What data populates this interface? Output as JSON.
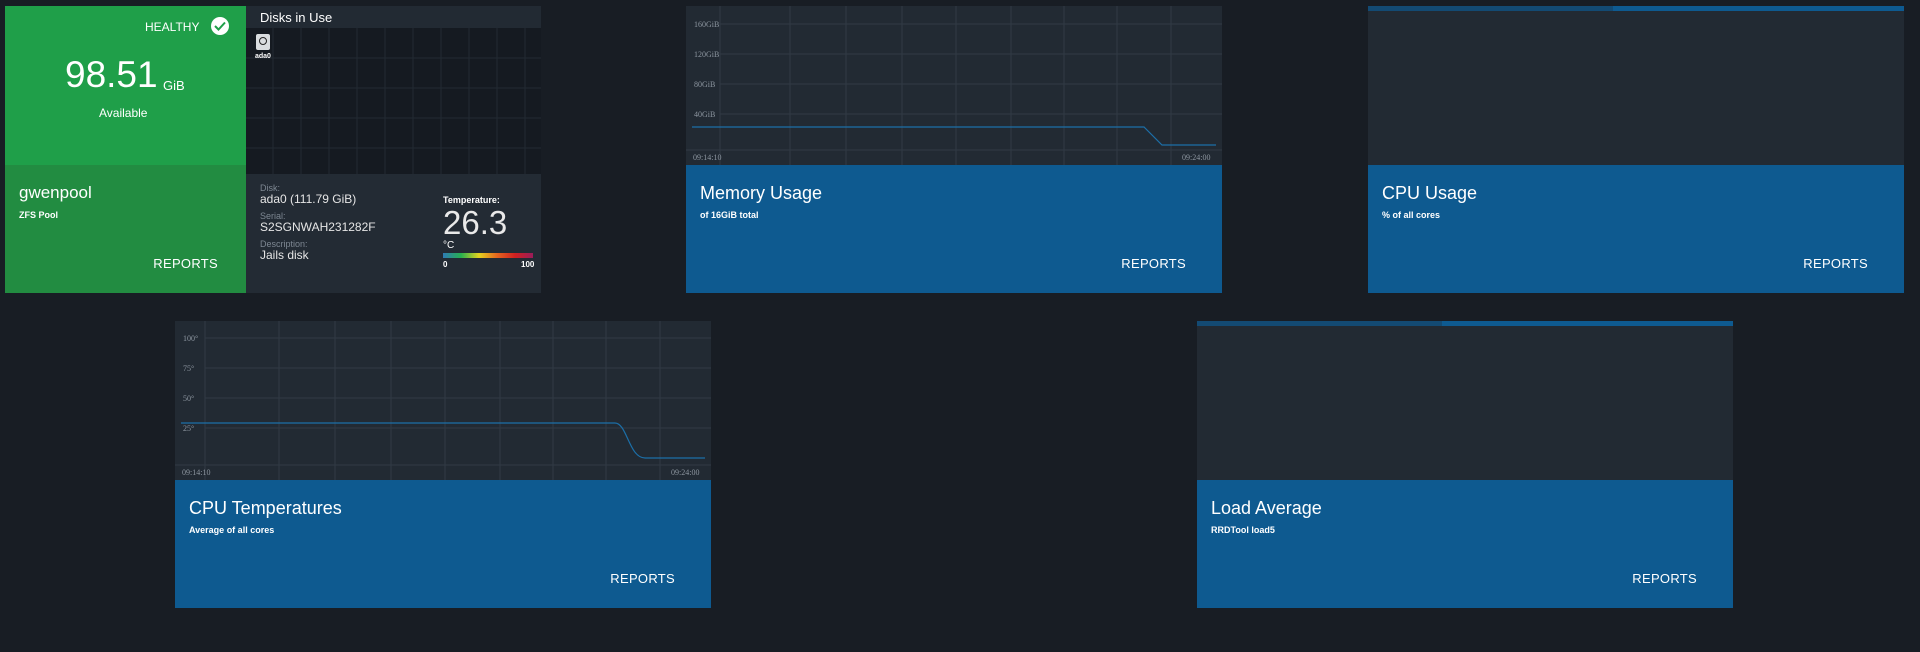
{
  "pool": {
    "status": "HEALTHY",
    "available_value": "98.51",
    "available_unit": "GiB",
    "available_label": "Available",
    "name": "gwenpool",
    "type": "ZFS Pool",
    "reports_label": "REPORTS",
    "disks_title": "Disks in Use",
    "disk_name": "ada0",
    "disk_label": "Disk:",
    "disk_value": "ada0 (111.79 GiB)",
    "serial_label": "Serial:",
    "serial_value": "S2SGNWAH231282F",
    "description_label": "Description:",
    "description_value": "Jails disk",
    "temperature_label": "Temperature:",
    "temperature_value": "26.3",
    "temperature_unit": "°C",
    "temp_scale_min": "0",
    "temp_scale_max": "100",
    "healthy_color": "#1f9f49"
  },
  "memory": {
    "title": "Memory Usage",
    "subtitle": "of 16GiB total",
    "reports_label": "REPORTS",
    "y_ticks": [
      "160GiB",
      "120GiB",
      "80GiB",
      "40GiB"
    ],
    "x_start": "09:14:10",
    "x_end": "09:24:00"
  },
  "cpu_usage": {
    "title": "CPU Usage",
    "subtitle": "% of all cores",
    "reports_label": "REPORTS"
  },
  "cpu_temp": {
    "title": "CPU Temperatures",
    "subtitle": "Average of all cores",
    "reports_label": "REPORTS",
    "y_ticks": [
      "100°",
      "75°",
      "50°",
      "25°"
    ],
    "x_start": "09:14:10",
    "x_end": "09:24:00"
  },
  "load": {
    "title": "Load Average",
    "subtitle": "RRDTool load5",
    "reports_label": "REPORTS"
  },
  "accent_color": "#0e5a90",
  "line_color": "#1c6fa8"
}
